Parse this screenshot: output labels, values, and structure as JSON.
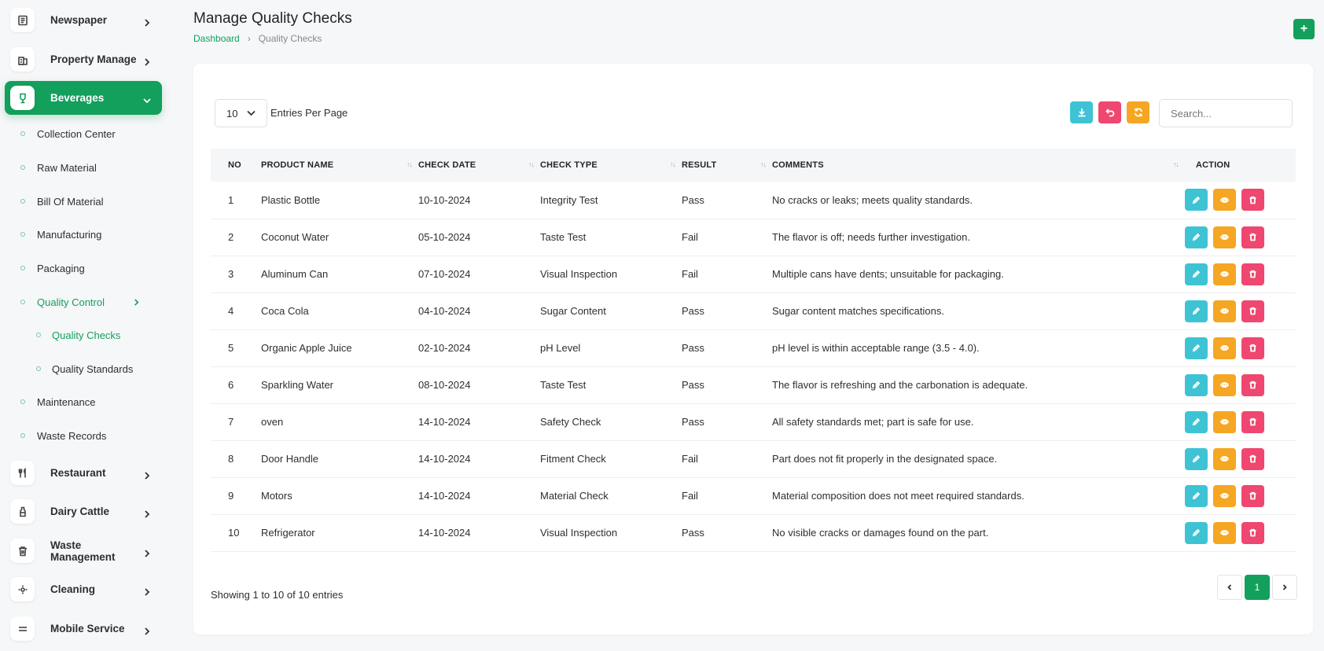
{
  "colors": {
    "accent": "#12a05c",
    "info": "#3ec3d5",
    "warning": "#f5a623",
    "danger": "#ef476f"
  },
  "sidebar": {
    "top_items": [
      {
        "label": "Newspaper",
        "icon": "newspaper-icon"
      },
      {
        "label": "Property Manage",
        "icon": "building-icon"
      }
    ],
    "active_item": {
      "label": "Beverages",
      "icon": "glass-icon"
    },
    "sub_items": [
      {
        "label": "Collection Center"
      },
      {
        "label": "Raw Material"
      },
      {
        "label": "Bill Of Material"
      },
      {
        "label": "Manufacturing"
      },
      {
        "label": "Packaging"
      },
      {
        "label": "Quality Control"
      },
      {
        "label": "Maintenance"
      },
      {
        "label": "Waste Records"
      }
    ],
    "quality_sub": [
      {
        "label": "Quality Checks"
      },
      {
        "label": "Quality Standards"
      }
    ],
    "bottom_items": [
      {
        "label": "Restaurant",
        "icon": "utensils-icon"
      },
      {
        "label": "Dairy Cattle",
        "icon": "bottle-icon"
      },
      {
        "label": "Waste Management",
        "icon": "trash-icon"
      },
      {
        "label": "Cleaning",
        "icon": "sparkle-icon"
      },
      {
        "label": "Mobile Service",
        "icon": "mobile-icon"
      }
    ]
  },
  "header": {
    "title": "Manage Quality Checks",
    "breadcrumb_home": "Dashboard",
    "breadcrumb_current": "Quality Checks",
    "add_label": "+"
  },
  "controls": {
    "entries_value": "10",
    "entries_label": "Entries Per Page",
    "search_placeholder": "Search..."
  },
  "table": {
    "headers": [
      "NO",
      "PRODUCT NAME",
      "CHECK DATE",
      "CHECK TYPE",
      "RESULT",
      "COMMENTS",
      "ACTION"
    ],
    "rows": [
      {
        "no": "1",
        "product": "Plastic Bottle",
        "date": "10-10-2024",
        "type": "Integrity Test",
        "result": "Pass",
        "comments": "No cracks or leaks; meets quality standards."
      },
      {
        "no": "2",
        "product": "Coconut Water",
        "date": "05-10-2024",
        "type": "Taste Test",
        "result": "Fail",
        "comments": "The flavor is off; needs further investigation."
      },
      {
        "no": "3",
        "product": "Aluminum Can",
        "date": "07-10-2024",
        "type": "Visual Inspection",
        "result": "Fail",
        "comments": "Multiple cans have dents; unsuitable for packaging."
      },
      {
        "no": "4",
        "product": "Coca Cola",
        "date": "04-10-2024",
        "type": "Sugar Content",
        "result": "Pass",
        "comments": "Sugar content matches specifications."
      },
      {
        "no": "5",
        "product": "Organic Apple Juice",
        "date": "02-10-2024",
        "type": "pH Level",
        "result": "Pass",
        "comments": "pH level is within acceptable range (3.5 - 4.0)."
      },
      {
        "no": "6",
        "product": "Sparkling Water",
        "date": "08-10-2024",
        "type": "Taste Test",
        "result": "Pass",
        "comments": "The flavor is refreshing and the carbonation is adequate."
      },
      {
        "no": "7",
        "product": "oven",
        "date": "14-10-2024",
        "type": "Safety Check",
        "result": "Pass",
        "comments": "All safety standards met; part is safe for use."
      },
      {
        "no": "8",
        "product": "Door Handle",
        "date": "14-10-2024",
        "type": "Fitment Check",
        "result": "Fail",
        "comments": "Part does not fit properly in the designated space."
      },
      {
        "no": "9",
        "product": "Motors",
        "date": "14-10-2024",
        "type": "Material Check",
        "result": "Fail",
        "comments": "Material composition does not meet required standards."
      },
      {
        "no": "10",
        "product": "Refrigerator",
        "date": "14-10-2024",
        "type": "Visual Inspection",
        "result": "Pass",
        "comments": "No visible cracks or damages found on the part."
      }
    ]
  },
  "footer": {
    "showing": "Showing 1 to 10 of 10 entries",
    "current_page": "1"
  }
}
